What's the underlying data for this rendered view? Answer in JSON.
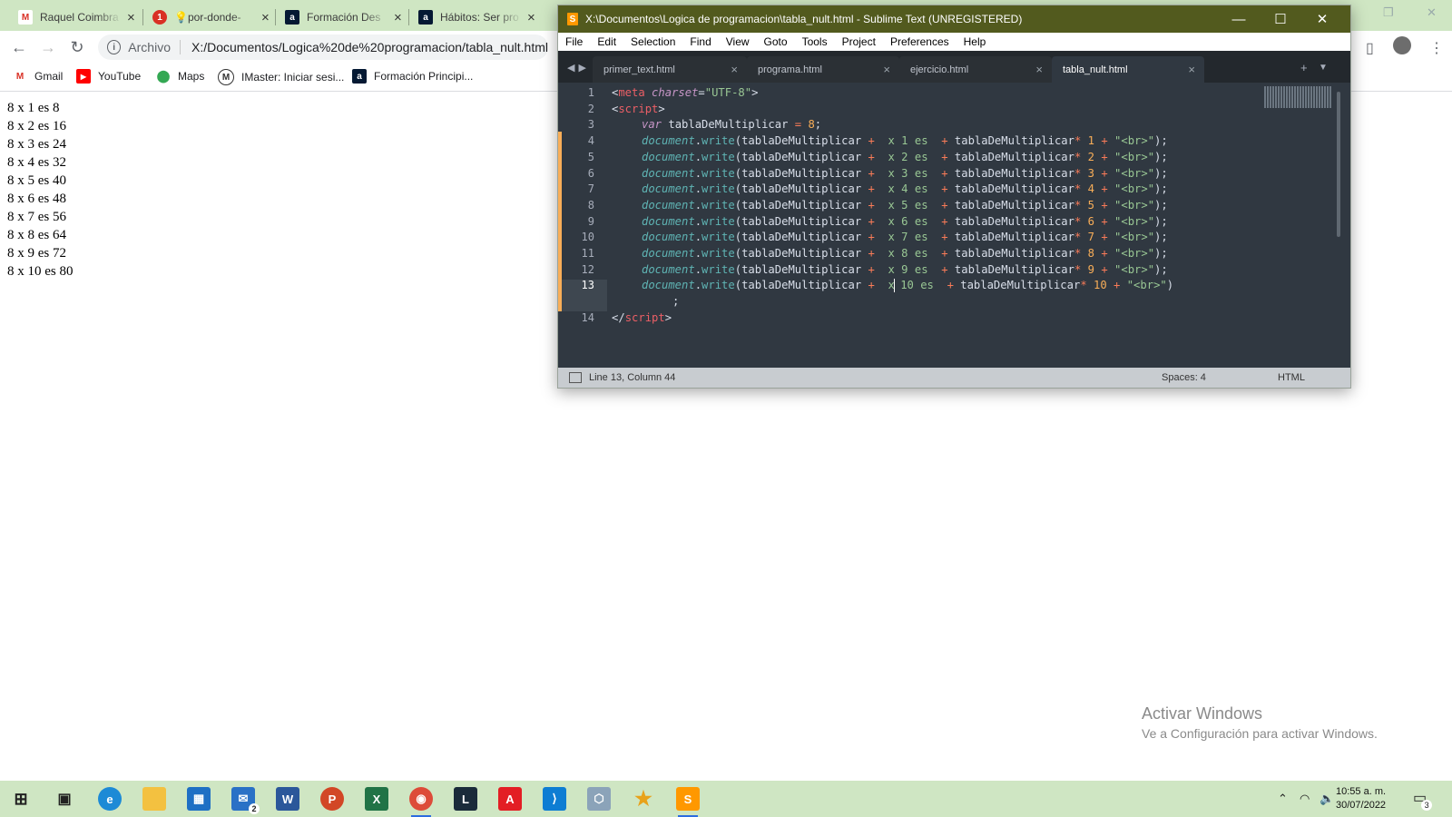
{
  "browser": {
    "tabs": [
      {
        "title": "Raquel Coimbra",
        "icon": "gmail-icon",
        "color": "#d93025"
      },
      {
        "title": "💡por-donde-",
        "icon": "chat-icon",
        "color": "#d93025"
      },
      {
        "title": "Formación Des",
        "icon": "alura-icon",
        "color": "#051933"
      },
      {
        "title": "Hábitos: Ser pro",
        "icon": "alura-icon",
        "color": "#051933"
      }
    ],
    "address": {
      "chip": "Archivo",
      "url": "X:/Documentos/Logica%20de%20programacion/tabla_nult.html"
    },
    "bookmarks": [
      {
        "label": "Gmail",
        "icon": "gmail-icon"
      },
      {
        "label": "YouTube",
        "icon": "youtube-icon"
      },
      {
        "label": "Maps",
        "icon": "maps-icon"
      },
      {
        "label": "IMaster: Iniciar sesi...",
        "icon": "imaster-icon"
      },
      {
        "label": "Formación Principi...",
        "icon": "alura-icon"
      }
    ],
    "page_lines": [
      "8 x 1 es 8",
      "8 x 2 es 16",
      "8 x 3 es 24",
      "8 x 4 es 32",
      "8 x 5 es 40",
      "8 x 6 es 48",
      "8 x 7 es 56",
      "8 x 8 es 64",
      "8 x 9 es 72",
      "8 x 10 es 80"
    ]
  },
  "sublime": {
    "title": "X:\\Documentos\\Logica de programacion\\tabla_nult.html - Sublime Text (UNREGISTERED)",
    "menu": [
      "File",
      "Edit",
      "Selection",
      "Find",
      "View",
      "Goto",
      "Tools",
      "Project",
      "Preferences",
      "Help"
    ],
    "tabs": [
      "primer_text.html",
      "programa.html",
      "ejercicio.html",
      "tabla_nult.html"
    ],
    "active_tab": "tabla_nult.html",
    "line_numbers": [
      "1",
      "2",
      "3",
      "4",
      "5",
      "6",
      "7",
      "8",
      "9",
      "10",
      "11",
      "12",
      "13",
      "",
      "14"
    ],
    "code": {
      "l1_open": "<",
      "l1_tag": "meta",
      "l1_attr": " charset",
      "l1_eq": "=",
      "l1_val": "\"UTF-8\"",
      "l1_close": ">",
      "l2_open": "<",
      "l2_tag": "script",
      "l2_close": ">",
      "l3_var": "var",
      "l3_name": " tablaDeMultiplicar ",
      "l3_eq": "=",
      "l3_num": " 8",
      "l3_semi": ";",
      "write_obj": "document",
      "write_dot": ".",
      "write_fn": "write",
      "write_paren": "(",
      "write_var": "tablaDeMultiplicar",
      "write_plus": " + ",
      "write_mult": "* ",
      "write_br": "\"<br>\"",
      "write_end": ");",
      "segments": [
        " x 1 es ",
        " x 2 es ",
        " x 3 es ",
        " x 4 es ",
        " x 5 es ",
        " x 6 es ",
        " x 7 es ",
        " x 8 es ",
        " x 9 es "
      ],
      "multipliers": [
        "1",
        "2",
        "3",
        "4",
        "5",
        "6",
        "7",
        "8",
        "9"
      ],
      "l13_seg_a": " x",
      "l13_seg_b": " 10 es ",
      "l13_num": "10",
      "l13_end": ")",
      "l13_wrap": ";",
      "l14_open": "</",
      "l14_tag": "script",
      "l14_close": ">"
    },
    "status": {
      "position": "Line 13, Column 44",
      "spaces": "Spaces: 4",
      "syntax": "HTML"
    }
  },
  "activate_windows": {
    "title": "Activar Windows",
    "subtitle": "Ve a Configuración para activar Windows."
  },
  "taskbar": {
    "time": "10:55 a. m.",
    "date": "30/07/2022",
    "mail_badge": "2",
    "notification_badge": "3"
  }
}
